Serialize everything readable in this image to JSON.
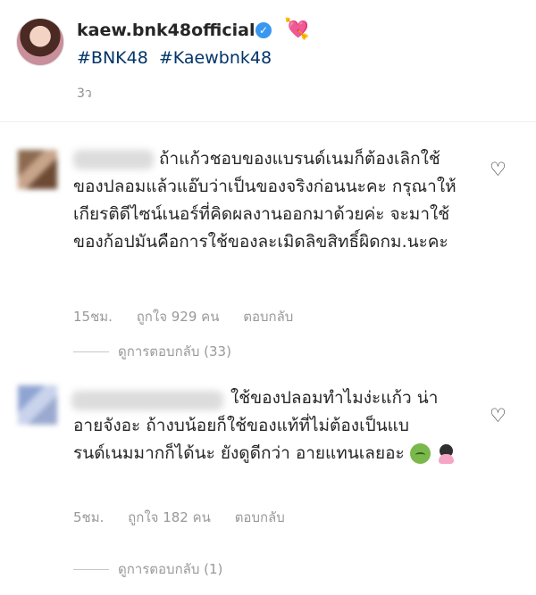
{
  "post": {
    "username": "kaew.bnk48official",
    "verified_icon": "verified-badge-icon",
    "emoji": "💘",
    "hashtags": [
      "#BNK48",
      "#Kaewbnk48"
    ],
    "time": "3ว"
  },
  "comments": [
    {
      "text": "ถ้าแก้วชอบของแบรนด์เนมก็ต้องเลิกใช้ของปลอมแล้วแอ๊บว่าเป็นของจริงก่อนนะคะ กรุณาให้เกียรติดีไซน์เนอร์ที่คิดผลงานออกมาด้วยค่ะ จะมาใช้ของก้อปมันคือการใช้ของละเมิดลิขสิทธิ์ผิดกม.นะคะ",
      "time": "15ชม.",
      "likes": "ถูกใจ 929 คน",
      "reply": "ตอบกลับ",
      "view_replies": "ดูการตอบกลับ (33)"
    },
    {
      "text": "ใช้ของปลอมทำไมง่ะแก้ว น่าอายจังอะ ถ้างบน้อยก็ใช้ของแท้ที่ไม่ต้องเป็นแบรนด์เนมมากก็ได้นะ ยังดูดีกว่า อายแทนเลยอะ",
      "time": "5ชม.",
      "likes": "ถูกใจ 182 คน",
      "reply": "ตอบกลับ",
      "view_replies": "ดูการตอบกลับ (1)"
    }
  ]
}
